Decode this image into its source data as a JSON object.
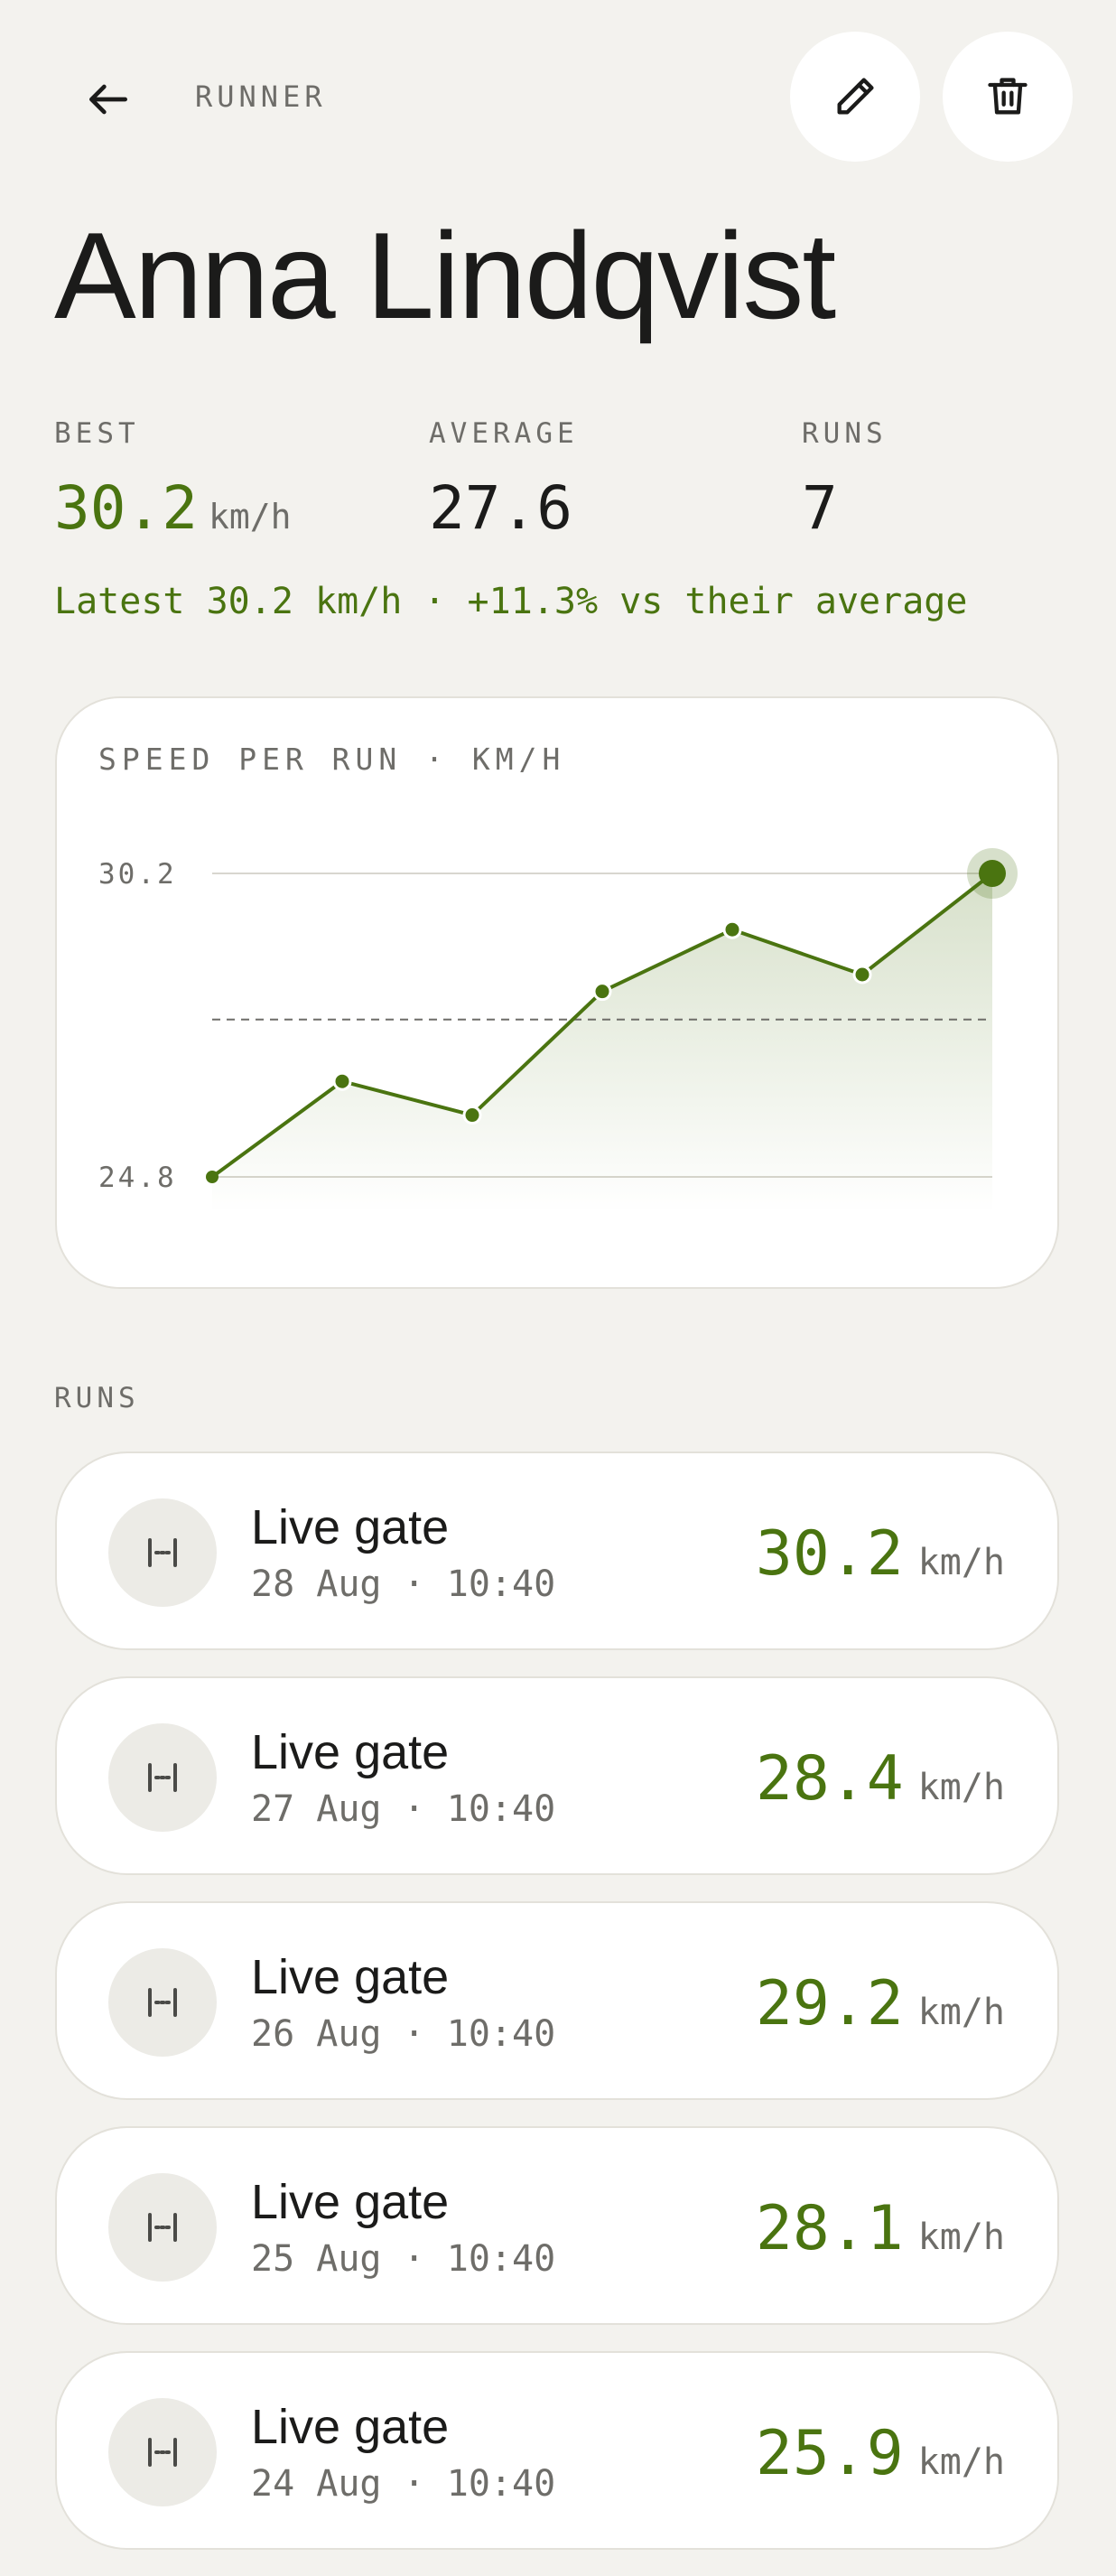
{
  "header": {
    "breadcrumb": "RUNNER",
    "back_icon": "arrow-left-icon",
    "edit_icon": "pencil-icon",
    "delete_icon": "trash-icon"
  },
  "runner": {
    "name": "Anna Lindqvist"
  },
  "stats": {
    "best": {
      "label": "BEST",
      "value": "30.2",
      "unit": "km/h"
    },
    "average": {
      "label": "AVERAGE",
      "value": "27.6"
    },
    "runs": {
      "label": "RUNS",
      "value": "7"
    },
    "delta_text": "Latest 30.2 km/h · +11.3% vs their average"
  },
  "chart_data": {
    "type": "line",
    "title": "SPEED PER RUN · KM/H",
    "y_max_label": "30.2",
    "y_min_label": "24.8",
    "ylim": [
      24.8,
      30.2
    ],
    "average": 27.6,
    "values": [
      24.8,
      26.5,
      25.9,
      28.1,
      29.2,
      28.4,
      30.2
    ],
    "fill": "area",
    "color": "#4a7410"
  },
  "runs": {
    "label": "RUNS",
    "items": [
      {
        "title": "Live gate",
        "meta": "28 Aug · 10:40",
        "speed": "30.2",
        "unit": "km/h",
        "icon": "gate-icon"
      },
      {
        "title": "Live gate",
        "meta": "27 Aug · 10:40",
        "speed": "28.4",
        "unit": "km/h",
        "icon": "gate-icon"
      },
      {
        "title": "Live gate",
        "meta": "26 Aug · 10:40",
        "speed": "29.2",
        "unit": "km/h",
        "icon": "gate-icon"
      },
      {
        "title": "Live gate",
        "meta": "25 Aug · 10:40",
        "speed": "28.1",
        "unit": "km/h",
        "icon": "gate-icon"
      },
      {
        "title": "Live gate",
        "meta": "24 Aug · 10:40",
        "speed": "25.9",
        "unit": "km/h",
        "icon": "gate-icon"
      }
    ]
  },
  "colors": {
    "accent": "#4a7410",
    "background": "#f3f2ee",
    "card": "#ffffff",
    "muted": "#6e6d69"
  }
}
